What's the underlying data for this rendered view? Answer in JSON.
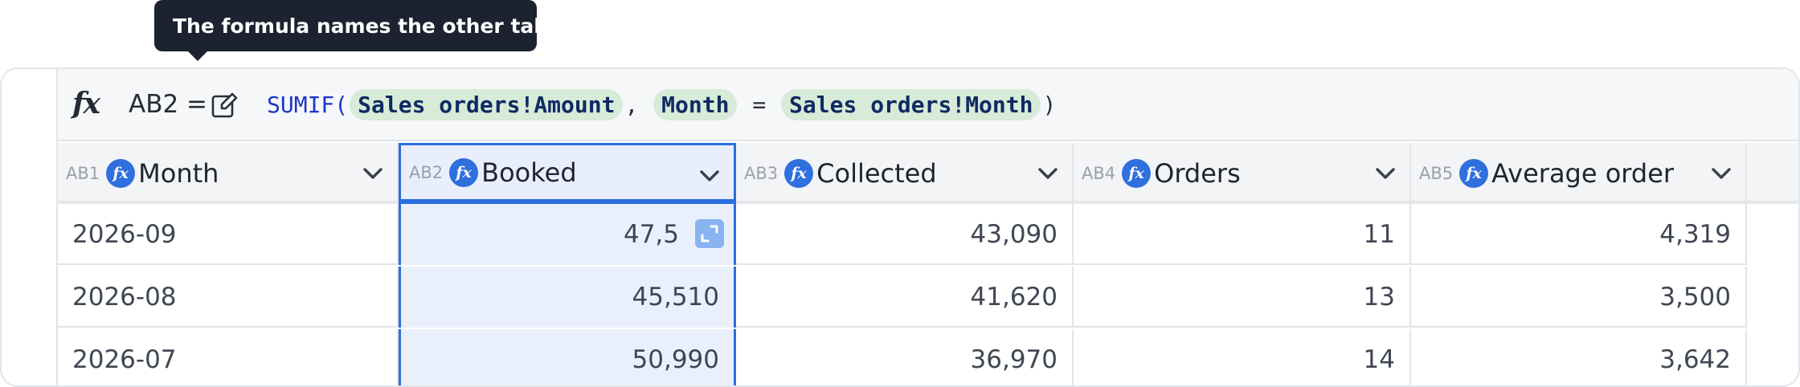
{
  "tooltip": {
    "text": "The formula names the other table"
  },
  "formula_bar": {
    "cell_ref": "AB2 =",
    "function": "SUMIF(",
    "arg1": "Sales orders!Amount",
    "sep1": ",",
    "arg2": "Month",
    "op": "=",
    "arg3": "Sales orders!Month",
    "close": ")"
  },
  "columns": [
    {
      "id": "AB1",
      "name": "Month"
    },
    {
      "id": "AB2",
      "name": "Booked"
    },
    {
      "id": "AB3",
      "name": "Collected"
    },
    {
      "id": "AB4",
      "name": "Orders"
    },
    {
      "id": "AB5",
      "name": "Average order"
    }
  ],
  "add_column_label": "+",
  "rows": [
    {
      "month": "2026-09",
      "booked": "47,5",
      "collected": "43,090",
      "orders": "11",
      "average": "4,319"
    },
    {
      "month": "2026-08",
      "booked": "45,510",
      "collected": "41,620",
      "orders": "13",
      "average": "3,500"
    },
    {
      "month": "2026-07",
      "booked": "50,990",
      "collected": "36,970",
      "orders": "14",
      "average": "3,642"
    }
  ],
  "icons": {
    "fx": "function-icon",
    "edit": "edit-icon",
    "chevron": "chevron-down-icon",
    "expand": "expand-icon"
  },
  "colors": {
    "accent": "#2a6ee0",
    "token_bg": "#d7ebd8",
    "tooltip_bg": "#1c2230"
  }
}
